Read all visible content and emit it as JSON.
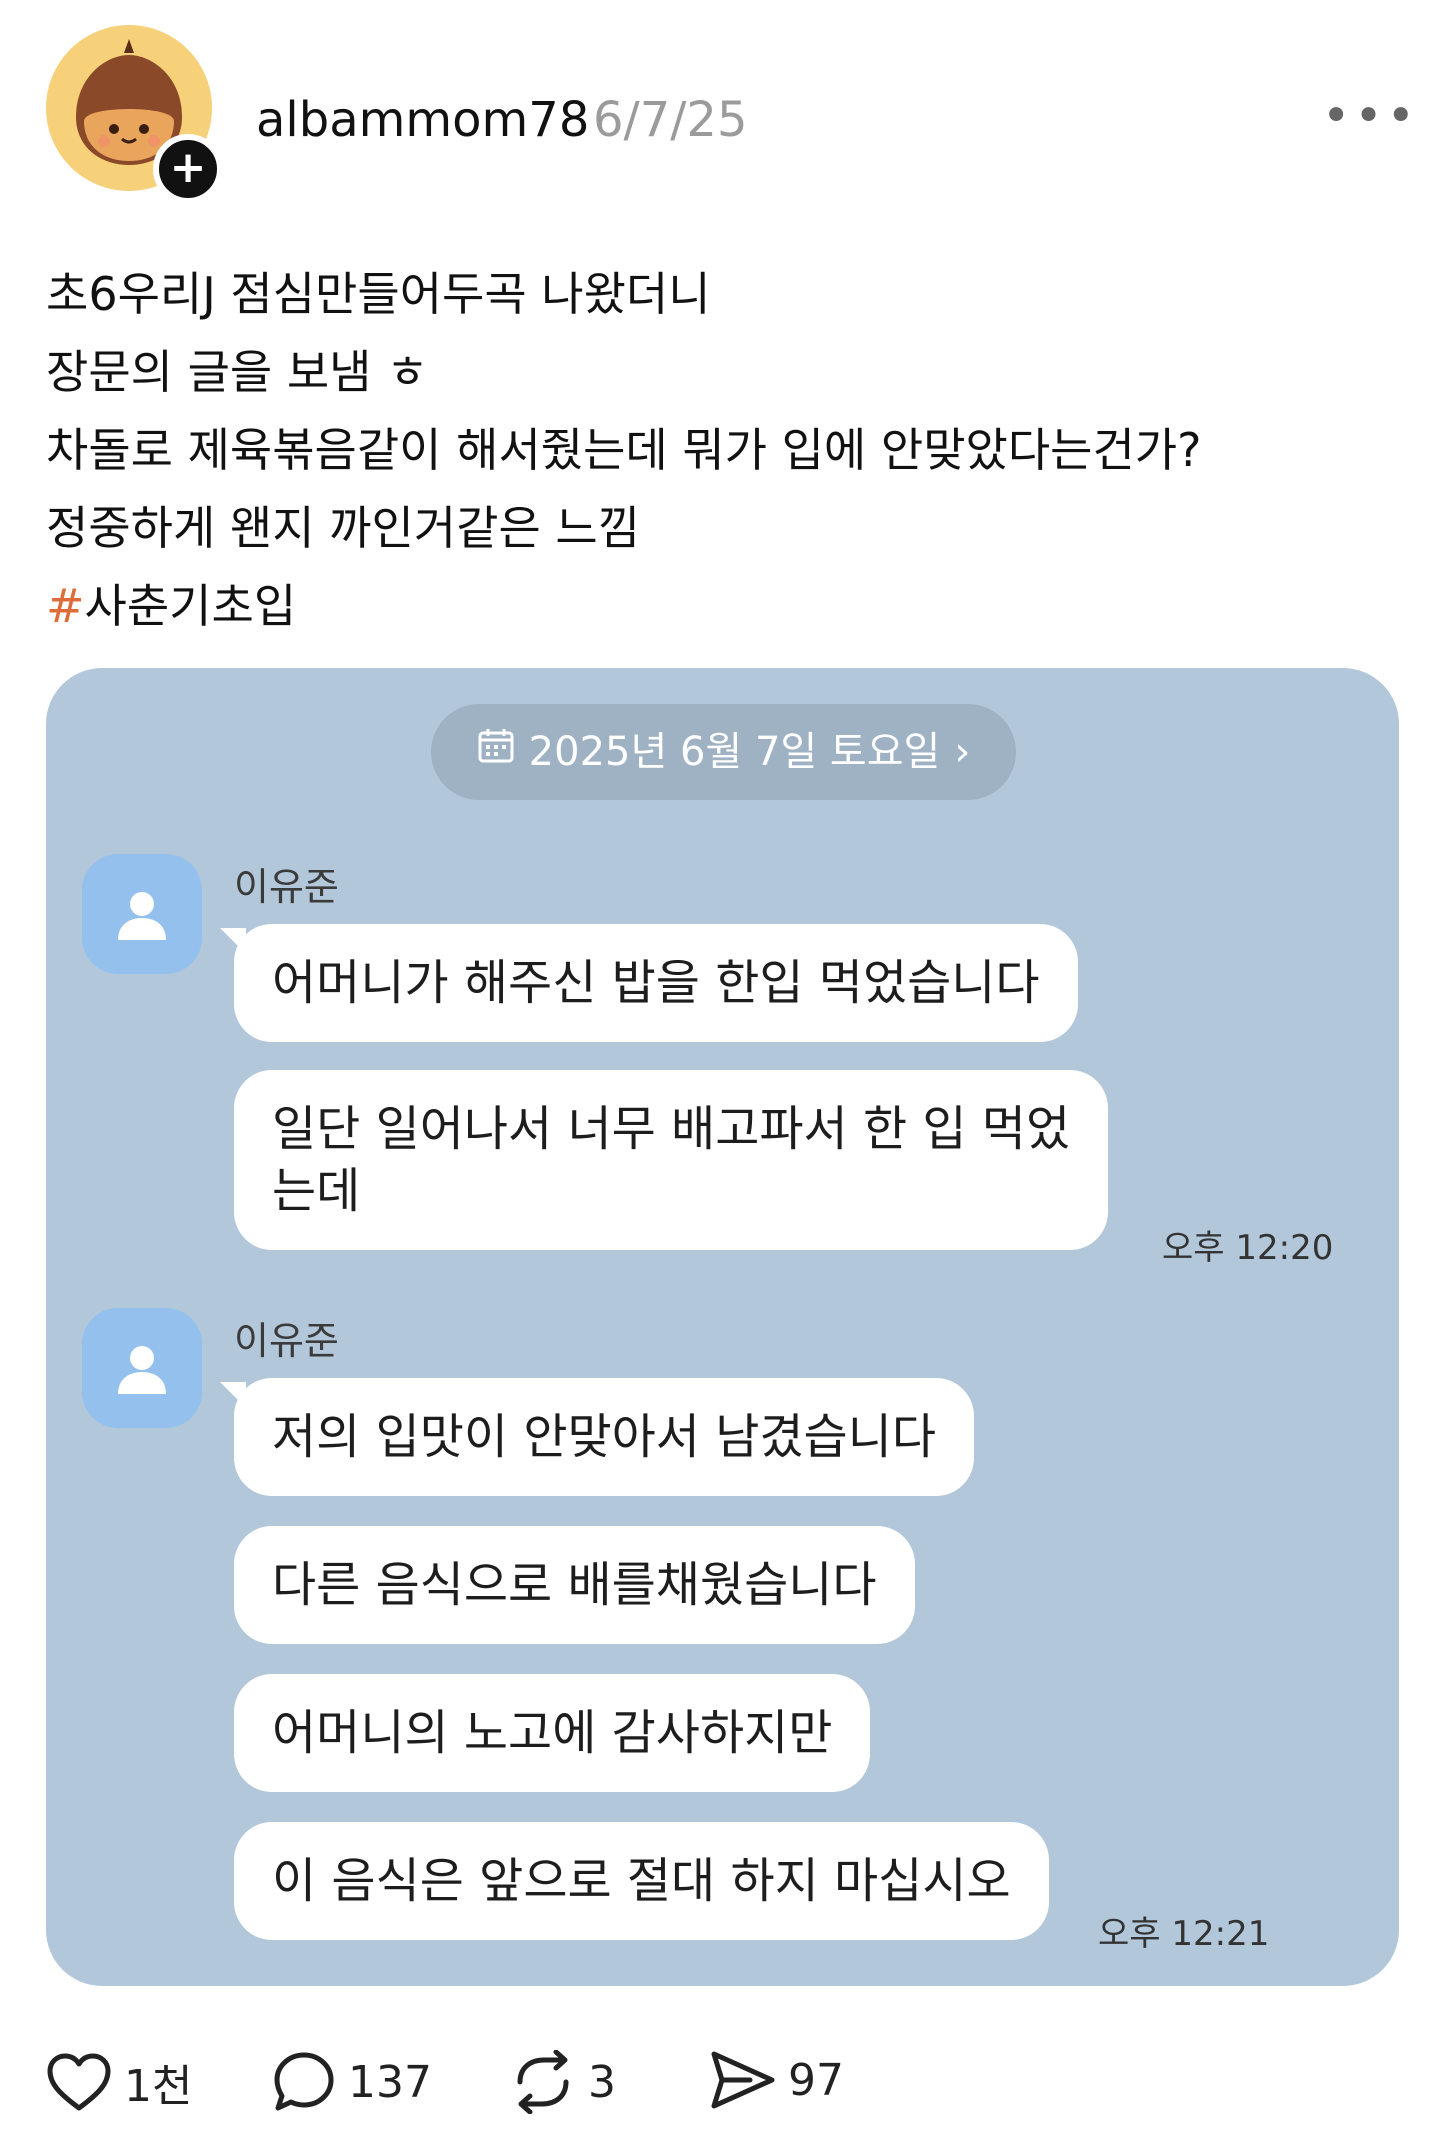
{
  "post": {
    "author": "albammom78",
    "date": "6/7/25",
    "more_icon": "more-horizontal-icon",
    "lines": [
      "초6우리J 점심만들어두곡 나왔더니",
      "장문의 글을 보냄 ㅎ",
      "차돌로 제육볶음같이 해서줬는데 뭐가 입에 안맞았다는건가?",
      "정중하게 왠지 까인거같은 느낌"
    ],
    "hashtag_symbol": "#",
    "hashtag": "사춘기초입"
  },
  "chat": {
    "date_pill": "2025년 6월 7일 토요일",
    "groups": [
      {
        "sender": "이유준",
        "messages": [
          "어머니가 해주신 밥을 한입 먹었습니다",
          "일단 일어나서 너무 배고파서 한 입 먹었\n는데"
        ],
        "time": "오후 12:20"
      },
      {
        "sender": "이유준",
        "messages": [
          "저의 입맛이 안맞아서 남겼습니다",
          "다른 음식으로 배를채웠습니다",
          "어머니의 노고에 감사하지만",
          "이 음식은 앞으로 절대 하지 마십시오"
        ],
        "time": "오후 12:21"
      }
    ]
  },
  "actions": {
    "likes": "1천",
    "comments": "137",
    "reposts": "3",
    "shares": "97"
  },
  "colors": {
    "chat_background": "#b2c7da",
    "hashtag_accent": "#e06b3a",
    "avatar_background": "#f7d07a"
  }
}
